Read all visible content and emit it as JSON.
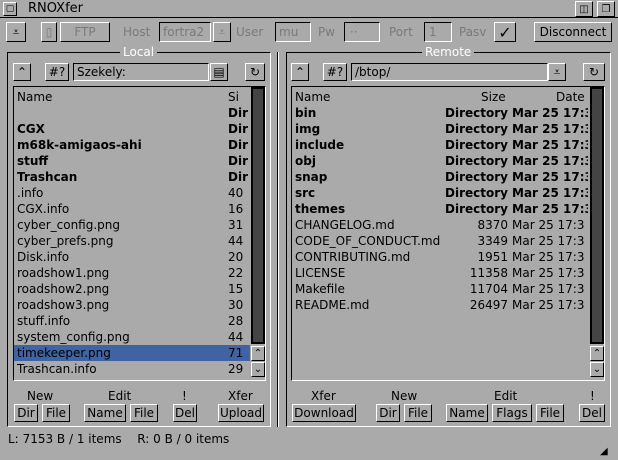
{
  "window": {
    "title": "RNOXfer"
  },
  "toolbar": {
    "ftp_label": "FTP",
    "host_label": "Host",
    "host_value": "fortra2",
    "user_label": "User",
    "user_value": "mu",
    "pw_label": "Pw",
    "pw_value": "··",
    "port_label": "Port",
    "port_value": "1",
    "pasv_label": "Pasv",
    "pasv_check": "✓",
    "disconnect_label": "Disconnect"
  },
  "local": {
    "title": "Local",
    "path": "Szekely:",
    "pattern_label": "#?",
    "col_name": "Name",
    "col_size": "Si",
    "rows": [
      {
        "name": "",
        "size": "Dir",
        "bold": true
      },
      {
        "name": "CGX",
        "size": "Dir",
        "bold": true
      },
      {
        "name": "m68k-amigaos-ahi",
        "size": "Dir",
        "bold": true
      },
      {
        "name": "stuff",
        "size": "Dir",
        "bold": true
      },
      {
        "name": "Trashcan",
        "size": "Dir",
        "bold": true
      },
      {
        "name": ".info",
        "size": "40",
        "bold": false
      },
      {
        "name": "CGX.info",
        "size": "16",
        "bold": false
      },
      {
        "name": "cyber_config.png",
        "size": "31",
        "bold": false
      },
      {
        "name": "cyber_prefs.png",
        "size": "44",
        "bold": false
      },
      {
        "name": "Disk.info",
        "size": "20",
        "bold": false
      },
      {
        "name": "roadshow1.png",
        "size": "22",
        "bold": false
      },
      {
        "name": "roadshow2.png",
        "size": "15",
        "bold": false
      },
      {
        "name": "roadshow3.png",
        "size": "30",
        "bold": false
      },
      {
        "name": "stuff.info",
        "size": "28",
        "bold": false
      },
      {
        "name": "system_config.png",
        "size": "44",
        "bold": false
      },
      {
        "name": "timekeeper.png",
        "size": "71",
        "bold": false,
        "selected": true
      },
      {
        "name": "Trashcan.info",
        "size": "29",
        "bold": false
      }
    ],
    "buttons": {
      "new_label": "New",
      "dir": "Dir",
      "file": "File",
      "edit_label": "Edit",
      "name": "Name",
      "edit_file": "File",
      "bang_label": "!",
      "del": "Del",
      "xfer_label": "Xfer",
      "upload": "Upload"
    }
  },
  "remote": {
    "title": "Remote",
    "path": "/btop/",
    "pattern_label": "#?",
    "col_name": "Name",
    "col_size": "Size",
    "col_date": "Date",
    "rows": [
      {
        "name": "bin",
        "size": "Directory",
        "date": "Mar 25 17:3",
        "bold": true
      },
      {
        "name": "img",
        "size": "Directory",
        "date": "Mar 25 17:3",
        "bold": true
      },
      {
        "name": "include",
        "size": "Directory",
        "date": "Mar 25 17:3",
        "bold": true
      },
      {
        "name": "obj",
        "size": "Directory",
        "date": "Mar 25 17:3",
        "bold": true
      },
      {
        "name": "snap",
        "size": "Directory",
        "date": "Mar 25 17:3",
        "bold": true
      },
      {
        "name": "src",
        "size": "Directory",
        "date": "Mar 25 17:3",
        "bold": true
      },
      {
        "name": "themes",
        "size": "Directory",
        "date": "Mar 25 17:3",
        "bold": true
      },
      {
        "name": "CHANGELOG.md",
        "size": "8370",
        "date": "Mar 25 17:3",
        "bold": false
      },
      {
        "name": "CODE_OF_CONDUCT.md",
        "size": "3349",
        "date": "Mar 25 17:3",
        "bold": false
      },
      {
        "name": "CONTRIBUTING.md",
        "size": "1951",
        "date": "Mar 25 17:3",
        "bold": false
      },
      {
        "name": "LICENSE",
        "size": "11358",
        "date": "Mar 25 17:3",
        "bold": false
      },
      {
        "name": "Makefile",
        "size": "11704",
        "date": "Mar 25 17:3",
        "bold": false
      },
      {
        "name": "README.md",
        "size": "26497",
        "date": "Mar 25 17:3",
        "bold": false
      }
    ],
    "buttons": {
      "xfer_label": "Xfer",
      "download": "Download",
      "new_label": "New",
      "dir": "Dir",
      "file": "File",
      "edit_label": "Edit",
      "name": "Name",
      "flags": "Flags",
      "edit_file": "File",
      "bang_label": "!",
      "del": "Del"
    }
  },
  "status": {
    "local_label": "L:",
    "local_value": "7153 B / 1 items",
    "remote_label": "R:",
    "remote_value": "0 B / 0 items"
  },
  "colors": {
    "background": "#aaaaaa",
    "selection": "#3f63a3",
    "scroll_track": "#000000"
  }
}
